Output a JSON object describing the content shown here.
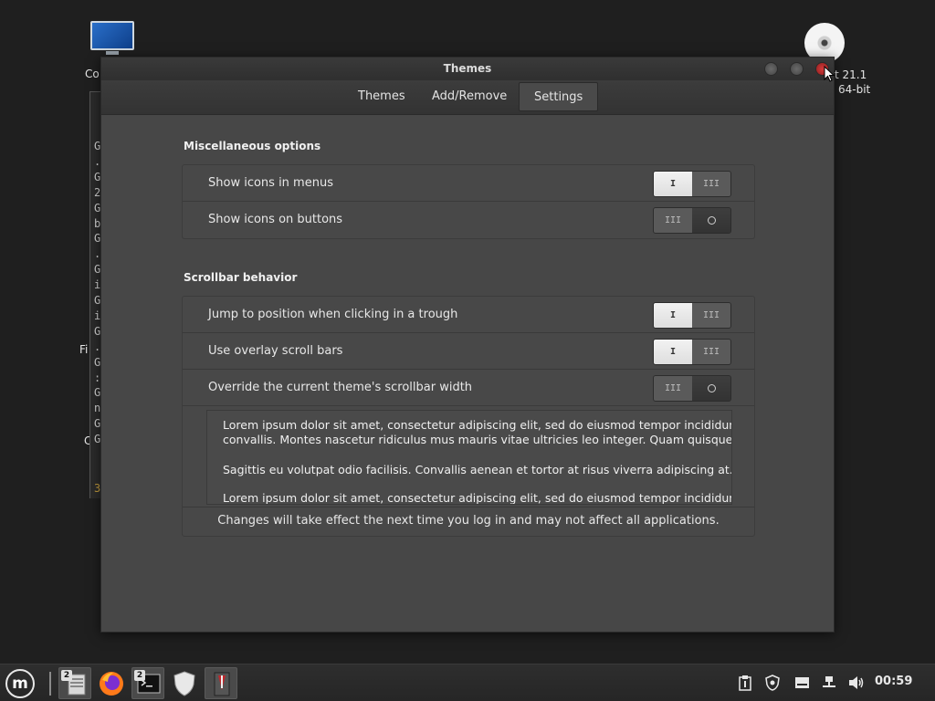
{
  "desktop": {
    "computer_label": "Co",
    "cd_label_1": "t 21.1",
    "cd_label_2": "64-bit",
    "side_labels": [
      "Fi",
      "Ci"
    ]
  },
  "terminal": {
    "lines": [
      "G",
      ".",
      "G",
      "2",
      "G",
      "b",
      "G",
      ".",
      "G",
      "i",
      "G",
      "i",
      "G",
      ".",
      "G",
      ":",
      "G",
      "n",
      "G",
      "G"
    ],
    "prompt_char": "3"
  },
  "window": {
    "title": "Themes",
    "tabs": [
      {
        "label": "Themes"
      },
      {
        "label": "Add/Remove"
      },
      {
        "label": "Settings"
      }
    ],
    "active_tab": "Settings"
  },
  "misc": {
    "title": "Miscellaneous options",
    "rows": [
      {
        "label": "Show icons in menus",
        "state": "on"
      },
      {
        "label": "Show icons on buttons",
        "state": "off"
      }
    ]
  },
  "scrollbar": {
    "title": "Scrollbar behavior",
    "rows": [
      {
        "label": "Jump to position when clicking in a trough",
        "state": "on"
      },
      {
        "label": "Use overlay scroll bars",
        "state": "on"
      },
      {
        "label": "Override the current theme's scrollbar width",
        "state": "off"
      }
    ],
    "lorem_1": "Lorem ipsum dolor sit amet, consectetur adipiscing elit, sed do eiusmod tempor incididunt ut",
    "lorem_2": "convallis. Montes nascetur ridiculus mus mauris vitae ultricies leo integer. Quam quisque id dia",
    "lorem_3": "Sagittis eu volutpat odio facilisis. Convallis aenean et tortor at risus viverra adipiscing at. Sapie",
    "lorem_4": "Lorem ipsum dolor sit amet, consectetur adipiscing elit, sed do eiusmod tempor incididunt ut",
    "note": "Changes will take effect the next time you log in and may not affect all applications."
  },
  "switch_glyphs": {
    "on_mark": "I",
    "bars": "III"
  },
  "taskbar": {
    "menu_glyph": "m",
    "files_badge": "2",
    "terminal_badge": "2",
    "clock": "00:59"
  },
  "colors": {
    "window_bg": "#474747",
    "close_button": "#d43b3b",
    "desktop_bg": "#1f1f1f"
  }
}
